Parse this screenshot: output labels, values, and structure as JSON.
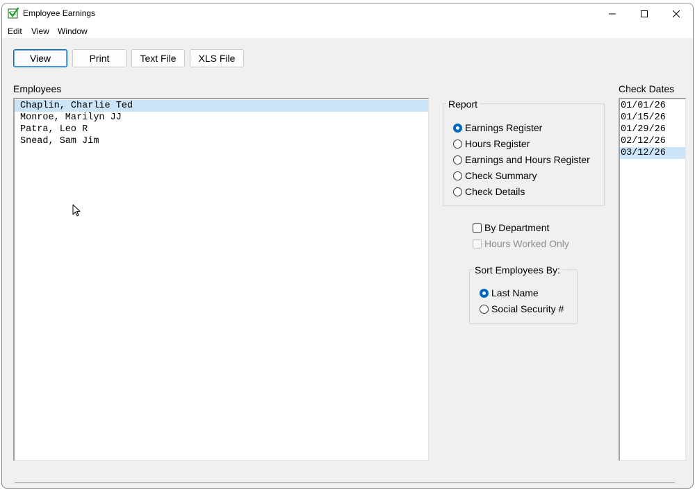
{
  "window": {
    "title": "Employee Earnings"
  },
  "menu": [
    "Edit",
    "View",
    "Window"
  ],
  "toolbar": {
    "view_label": "View",
    "print_label": "Print",
    "text_file_label": "Text File",
    "xls_file_label": "XLS File"
  },
  "employees": {
    "label": "Employees",
    "items": [
      "Chaplin, Charlie Ted",
      "Monroe, Marilyn JJ",
      "Patra, Leo R",
      "Snead, Sam Jim"
    ],
    "selected_index": 0
  },
  "report": {
    "title": "Report",
    "options": [
      "Earnings Register",
      "Hours Register",
      "Earnings and Hours Register",
      "Check Summary",
      "Check Details"
    ],
    "selected_index": 0
  },
  "options": {
    "by_department": "By Department",
    "hours_worked_only": "Hours Worked Only"
  },
  "sort": {
    "title": "Sort Employees By:",
    "options": [
      "Last Name",
      "Social Security #"
    ],
    "selected_index": 0
  },
  "check_dates": {
    "label": "Check Dates",
    "items": [
      "01/01/26",
      "01/15/26",
      "01/29/26",
      "02/12/26",
      "03/12/26"
    ],
    "selected_index": 4
  },
  "colors": {
    "accent": "#0067c0",
    "selection": "#cce4f7",
    "window_bg": "#f0f0f0"
  }
}
